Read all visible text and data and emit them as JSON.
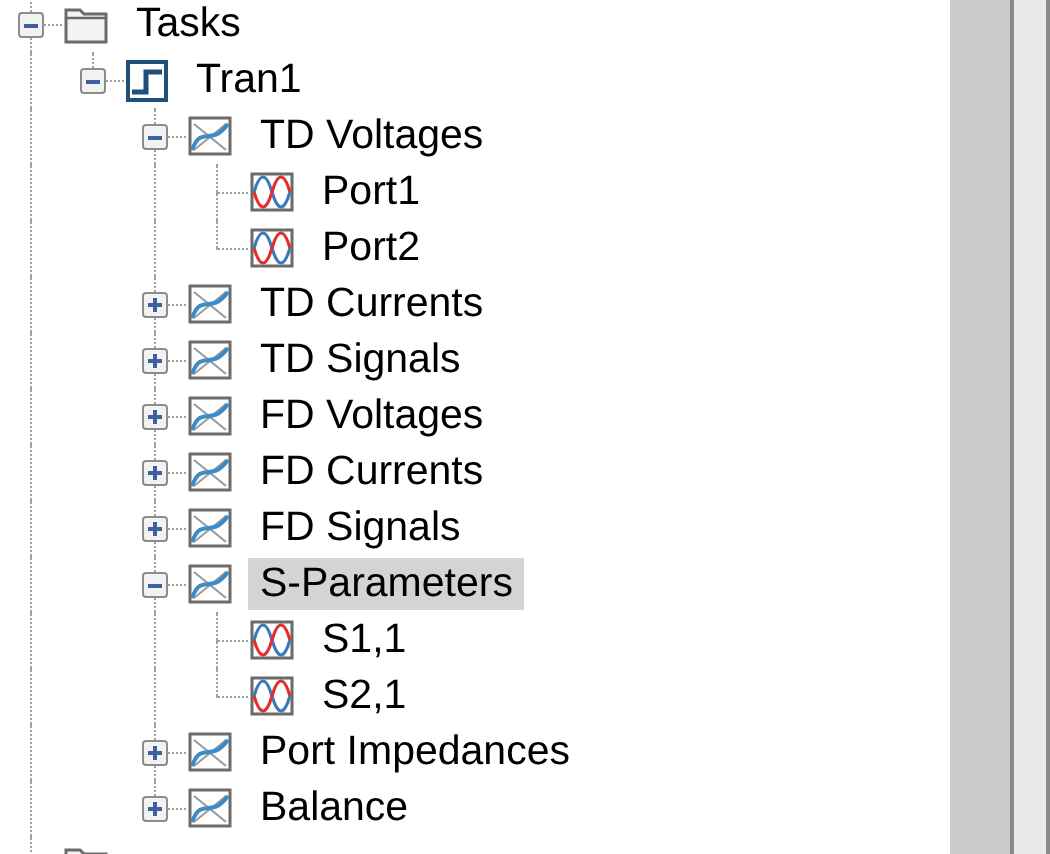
{
  "tree": [
    {
      "kind": "folder",
      "label": "Tasks",
      "expanded": true,
      "selected": false,
      "children": [
        {
          "kind": "step",
          "label": "Tran1",
          "expanded": true,
          "selected": false,
          "children": [
            {
              "kind": "chart",
              "label": "TD Voltages",
              "expanded": true,
              "selected": false,
              "children": [
                {
                  "kind": "wave",
                  "label": "Port1",
                  "selected": false
                },
                {
                  "kind": "wave",
                  "label": "Port2",
                  "selected": false
                }
              ]
            },
            {
              "kind": "chart",
              "label": "TD Currents",
              "expanded": false,
              "selected": false
            },
            {
              "kind": "chart",
              "label": "TD Signals",
              "expanded": false,
              "selected": false
            },
            {
              "kind": "chart",
              "label": "FD Voltages",
              "expanded": false,
              "selected": false
            },
            {
              "kind": "chart",
              "label": "FD Currents",
              "expanded": false,
              "selected": false
            },
            {
              "kind": "chart",
              "label": "FD Signals",
              "expanded": false,
              "selected": false
            },
            {
              "kind": "chart",
              "label": "S-Parameters",
              "expanded": true,
              "selected": true,
              "children": [
                {
                  "kind": "wave",
                  "label": "S1,1",
                  "selected": false
                },
                {
                  "kind": "wave",
                  "label": "S2,1",
                  "selected": false
                }
              ]
            },
            {
              "kind": "chart",
              "label": "Port Impedances",
              "expanded": false,
              "selected": false
            },
            {
              "kind": "chart",
              "label": "Balance",
              "expanded": false,
              "selected": false
            }
          ]
        }
      ]
    },
    {
      "kind": "folder",
      "selected": false
    }
  ]
}
